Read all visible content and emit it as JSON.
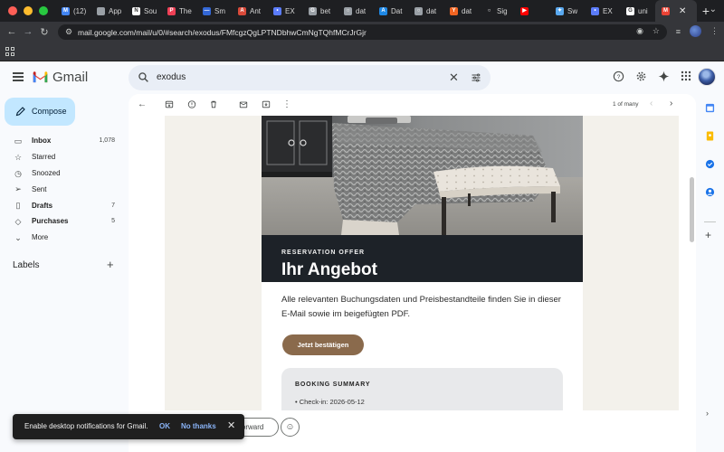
{
  "browser": {
    "tabs": [
      {
        "label": "(12)",
        "icon": "gmail-icon",
        "color": "#4285f4",
        "glyph": "M"
      },
      {
        "label": "App",
        "icon": "app-icon",
        "color": "#9aa0a6",
        "glyph": ""
      },
      {
        "label": "Sou",
        "icon": "notion-icon",
        "color": "#ffffff",
        "glyph": "N"
      },
      {
        "label": "The",
        "icon": "pocket-icon",
        "color": "#ef4056",
        "glyph": "P"
      },
      {
        "label": "Sm",
        "icon": "sm-icon",
        "color": "#3367d6",
        "glyph": "—"
      },
      {
        "label": "Ant",
        "icon": "anthropic-icon",
        "color": "#d94a3a",
        "glyph": "A"
      },
      {
        "label": "EX",
        "icon": "exodus-icon",
        "color": "#5b7cfa",
        "glyph": "•"
      },
      {
        "label": "bet",
        "icon": "globe-icon",
        "color": "#9aa0a6",
        "glyph": "G"
      },
      {
        "label": "dat",
        "icon": "globe-icon",
        "color": "#9aa0a6",
        "glyph": "○"
      },
      {
        "label": "Dat",
        "icon": "appstore-icon",
        "color": "#1e88e5",
        "glyph": "A"
      },
      {
        "label": "dat",
        "icon": "globe-icon",
        "color": "#9aa0a6",
        "glyph": "○"
      },
      {
        "label": "dat",
        "icon": "ycombinator-icon",
        "color": "#f26522",
        "glyph": "Y"
      },
      {
        "label": "Sig",
        "icon": "github-icon",
        "color": "#1e1f22",
        "glyph": "○"
      },
      {
        "label": "",
        "icon": "youtube-icon",
        "color": "#ff0000",
        "glyph": "▶"
      },
      {
        "label": "Sw",
        "icon": "spark-icon",
        "color": "#5aa9f0",
        "glyph": "✦"
      },
      {
        "label": "EX",
        "icon": "exodus-icon",
        "color": "#5b7cfa",
        "glyph": "•"
      },
      {
        "label": "uni",
        "icon": "google-icon",
        "color": "#ffffff",
        "glyph": "G"
      },
      {
        "label": "",
        "icon": "gmail-icon",
        "color": "#ea4335",
        "glyph": "M",
        "active": true
      }
    ],
    "url": "mail.google.com/mail/u/0/#search/exodus/FMfcgzQgLPTNDbhwCmNgTQhfMCrJrGjr"
  },
  "gmail": {
    "logo_text": "Gmail",
    "search_value": "exodus",
    "compose_label": "Compose",
    "nav": [
      {
        "label": "Inbox",
        "count": "1,078",
        "bold": true,
        "icon": "inbox-icon"
      },
      {
        "label": "Starred",
        "count": "",
        "bold": false,
        "icon": "star-icon"
      },
      {
        "label": "Snoozed",
        "count": "",
        "bold": false,
        "icon": "clock-icon"
      },
      {
        "label": "Sent",
        "count": "",
        "bold": false,
        "icon": "send-icon"
      },
      {
        "label": "Drafts",
        "count": "7",
        "bold": true,
        "icon": "draft-icon"
      },
      {
        "label": "Purchases",
        "count": "5",
        "bold": true,
        "icon": "tag-icon"
      },
      {
        "label": "More",
        "count": "",
        "bold": false,
        "icon": "chevron-down-icon"
      }
    ],
    "labels_heading": "Labels",
    "pager_text": "1 of many"
  },
  "email": {
    "eyebrow": "RESERVATION OFFER",
    "headline": "Ihr Angebot",
    "body": "Alle relevanten Buchungsdaten und Preisbestandteile finden Sie in dieser E-Mail sowie im beigefügten PDF.",
    "cta": "Jetzt bestätigen",
    "summary_title": "BOOKING SUMMARY",
    "summary_line": "• Check-in: 2026-05-12",
    "accent_color": "#8a6a4c",
    "band_color": "#1d2228"
  },
  "footer": {
    "forward_label": "Forward"
  },
  "toast": {
    "message": "Enable desktop notifications for Gmail.",
    "ok": "OK",
    "no_thanks": "No thanks"
  }
}
